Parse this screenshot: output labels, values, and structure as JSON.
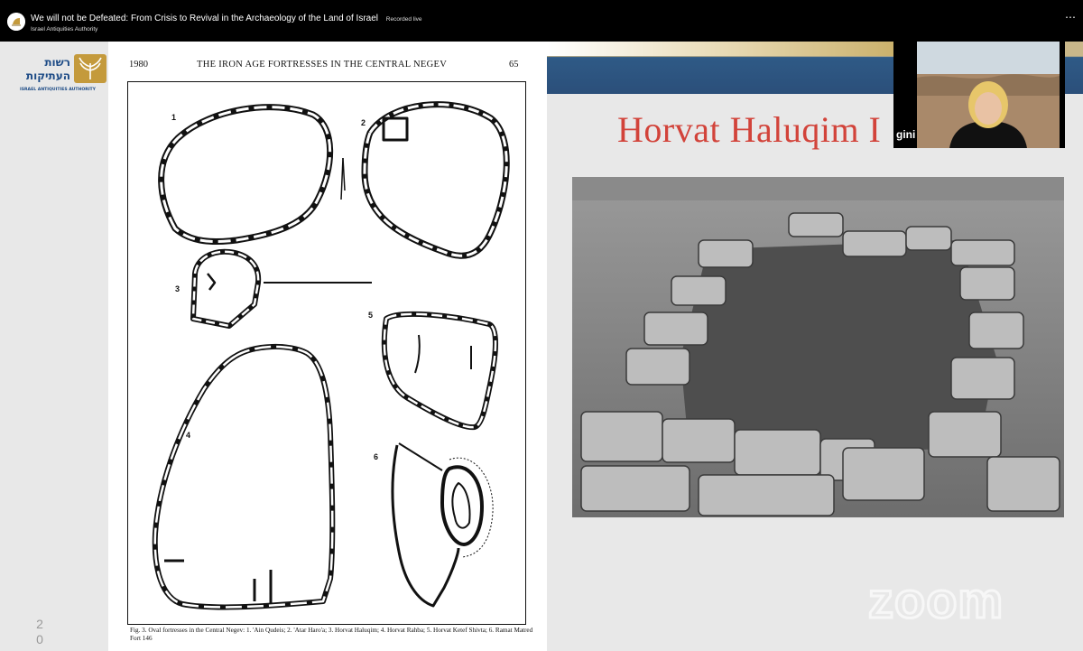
{
  "header": {
    "title": "We will not be Defeated: From Crisis to Revival in the Archaeology of the Land of Israel",
    "recorded": "Recorded live",
    "channel": "Israel Antiquities Authority",
    "more_icon": "more-dots-icon"
  },
  "sidebar": {
    "logo_hebrew_1": "רשות",
    "logo_hebrew_2": "העתיקות",
    "logo_english": "ISRAEL ANTIQUITIES AUTHORITY",
    "slide_number_1": "2",
    "slide_number_2": "0"
  },
  "scan": {
    "year": "1980",
    "running_title": "THE IRON AGE FORTRESSES IN THE CENTRAL NEGEV",
    "page_number": "65",
    "labels": [
      "1",
      "2",
      "3",
      "4",
      "5",
      "6"
    ],
    "caption": "Fig. 3. Oval fortresses in the Central Negev: 1. 'Ain Qudeis; 2. 'Atar Haro'a; 3. Horvat Haluqim; 4. Horvat Rahba; 5. Horvat Ketef Shivta; 6. Ramat Matred Fort 146"
  },
  "slide": {
    "title": "Horvat Haluqim I"
  },
  "video": {
    "name": "gini"
  },
  "watermark": "zoom",
  "colors": {
    "title_red": "#d2433a",
    "banner_blue": "#2b4f7a",
    "banner_gold": "#c9b78a"
  }
}
